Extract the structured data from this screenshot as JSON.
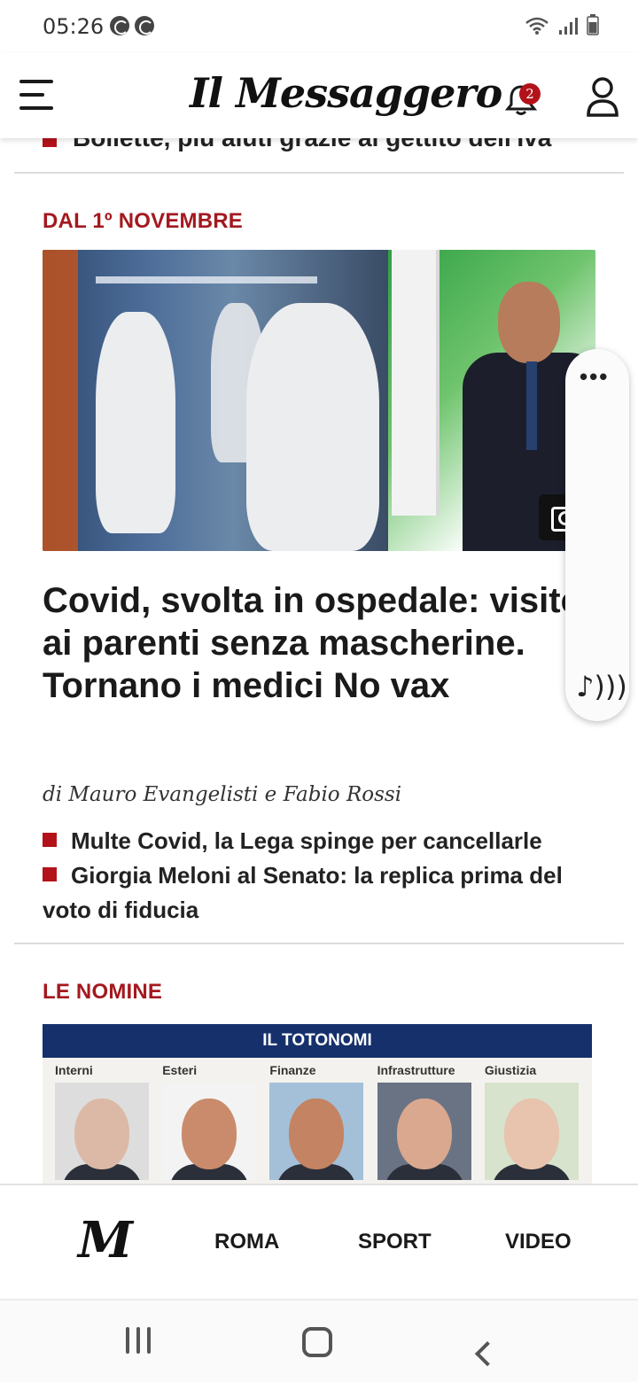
{
  "status_bar": {
    "time": "05:26"
  },
  "header": {
    "logo": "Il Messaggero",
    "notification_count": "2"
  },
  "previous_item": {
    "text": "Bollette, più aiuti grazie al gettito dell'Iva"
  },
  "main_article": {
    "kicker": "DAL 1º NOVEMBRE",
    "headline": "Covid, svolta in ospedale: visite ai parenti senza mascherine. Tornano i medici No vax",
    "byline": "di Mauro Evangelisti e Fabio Rossi",
    "related": [
      "Multe Covid, la Lega spinge per cancellarle",
      "Giorgia Meloni al Senato: la replica prima del voto di fiducia"
    ]
  },
  "second_article": {
    "kicker": "LE NOMINE",
    "image": {
      "title": "IL TOTONOMI",
      "columns": [
        "Interni",
        "Esteri",
        "Finanze",
        "Infrastrutture",
        "Giustizia"
      ]
    }
  },
  "float_panel": {
    "menu_glyph": "•••",
    "audio_glyph": "♪)))"
  },
  "tab_bar": {
    "home_logo": "M",
    "tabs": [
      "ROMA",
      "SPORT",
      "VIDEO"
    ]
  },
  "colors": {
    "accent_red": "#a3191f",
    "bullet_red": "#b3121a",
    "totonomi_blue": "#15306b"
  }
}
